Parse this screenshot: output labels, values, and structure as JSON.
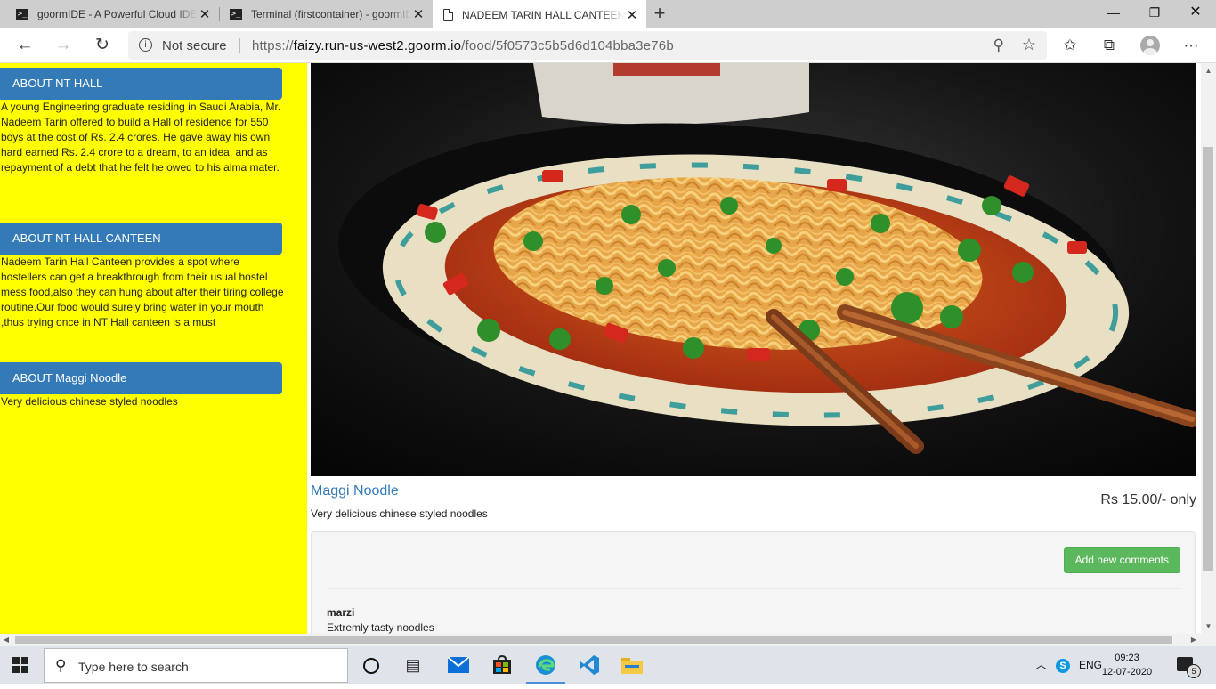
{
  "browser": {
    "tabs": [
      {
        "title": "goormIDE - A Powerful Cloud IDE",
        "icon": "terminal-icon",
        "active": false
      },
      {
        "title": "Terminal (firstcontainer) - goormIDE",
        "icon": "terminal-icon",
        "active": false
      },
      {
        "title": "NADEEM TARIN HALL CANTEEN",
        "icon": "document-icon",
        "active": true
      }
    ],
    "security_label": "Not secure",
    "url_scheme": "https://",
    "url_host": "faizy.run-us-west2.goorm.io",
    "url_path": "/food/5f0573c5b5d6d104bba3e76b"
  },
  "sidebar": {
    "sections": [
      {
        "heading": "ABOUT NT HALL",
        "text": "A young Engineering graduate residing in Saudi Arabia, Mr. Nadeem Tarin offered to build a Hall of residence for 550 boys at the cost of Rs. 2.4 crores. He gave away his own hard earned Rs. 2.4 crore to a dream, to an idea, and as repayment of a debt that he felt he owed to his alma mater."
      },
      {
        "heading": "ABOUT NT HALL CANTEEN",
        "text": "Nadeem Tarin Hall Canteen provides a spot where hostellers can get a breakthrough from their usual hostel mess food,also they can hung about after their tiring college routine.Our food would surely bring water in your mouth ,thus trying once in NT Hall canteen is a must"
      },
      {
        "heading": "ABOUT Maggi Noodle",
        "text": "Very delicious chinese styled noodles"
      }
    ]
  },
  "food": {
    "name": "Maggi Noodle",
    "price": "Rs 15.00/- only",
    "description": "Very delicious chinese styled noodles"
  },
  "comments": {
    "add_button_label": "Add new comments",
    "items": [
      {
        "author": "marzi",
        "text": "Extremly tasty noodles"
      }
    ]
  },
  "taskbar": {
    "search_placeholder": "Type here to search",
    "language": "ENG",
    "time": "09:23",
    "date": "12-07-2020",
    "notification_count": "5"
  }
}
